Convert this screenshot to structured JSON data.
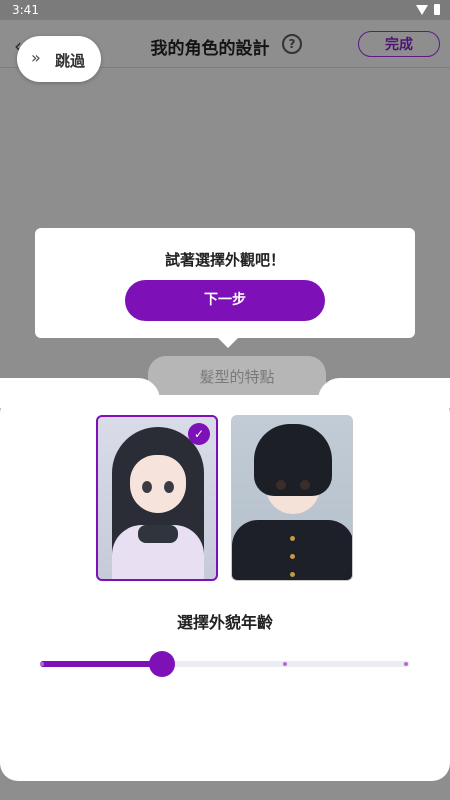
{
  "status_bar": {
    "time": "3:41"
  },
  "header": {
    "title": "我的角色的設計",
    "help": "?",
    "done_label": "完成"
  },
  "skip": {
    "label": "跳過"
  },
  "tooltip": {
    "text": "試著選擇外觀吧！",
    "next_label": "下一步"
  },
  "section": {
    "tab_label": "髮型的特點"
  },
  "appearance": {
    "options": [
      {
        "name": "girl-long-black-hair",
        "selected": true
      },
      {
        "name": "boy-black-hair",
        "selected": false
      }
    ]
  },
  "age": {
    "title": "選擇外貌年齡",
    "value": 0.33,
    "steps": 3
  },
  "colors": {
    "accent": "#7e10b8",
    "overlay": "#8e8e8e"
  }
}
